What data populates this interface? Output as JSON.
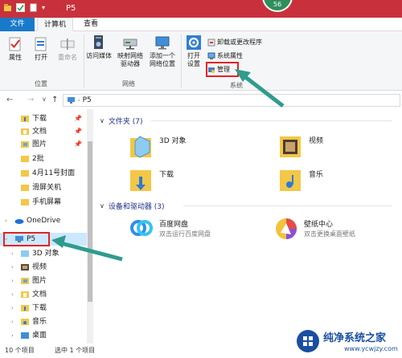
{
  "window": {
    "title": "P5",
    "badge": "56",
    "accent": "#c8313b"
  },
  "tabs": {
    "file": "文件",
    "computer": "计算机",
    "view": "查看"
  },
  "ribbon": {
    "properties": "属性",
    "open": "打开",
    "rename": "重命名",
    "location_group": "位置",
    "access_media": "访问媒体",
    "map_drive_l1": "映射网络",
    "map_drive_l2": "驱动器",
    "add_location_l1": "添加一个",
    "add_location_l2": "网络位置",
    "network_group": "网络",
    "open_settings_l1": "打开",
    "open_settings_l2": "设置",
    "uninstall": "卸载或更改程序",
    "system_props": "系统属性",
    "manage": "管理",
    "system_group": "系统"
  },
  "address": {
    "back": "←",
    "forward": "→",
    "dropdown": "∨",
    "up": "↑",
    "path": "P5"
  },
  "nav": {
    "items": [
      {
        "label": "下载",
        "pinned": true
      },
      {
        "label": "文档",
        "pinned": true
      },
      {
        "label": "图片",
        "pinned": true
      },
      {
        "label": "2批"
      },
      {
        "label": "4月11号封面"
      },
      {
        "label": "滑屏关机"
      },
      {
        "label": "手机屏幕"
      },
      {
        "label": "OneDrive"
      },
      {
        "label": "P5"
      },
      {
        "label": "3D 对象"
      },
      {
        "label": "视频"
      },
      {
        "label": "图片"
      },
      {
        "label": "文档"
      },
      {
        "label": "下载"
      },
      {
        "label": "音乐"
      },
      {
        "label": "桌面"
      }
    ]
  },
  "content": {
    "folders_header": "文件夹 (7)",
    "folders": [
      {
        "label": "3D 对象"
      },
      {
        "label": "视频"
      },
      {
        "label": "下载"
      },
      {
        "label": "音乐"
      }
    ],
    "devices_header": "设备和驱动器 (3)",
    "devices": [
      {
        "label": "百度网盘",
        "sub": "双击运行百度网盘"
      },
      {
        "label": "壁纸中心",
        "sub": "双击更换桌面壁纸"
      }
    ]
  },
  "status": {
    "items_count": "10 个项目",
    "selected": "选中 1 个项目"
  },
  "watermark": {
    "name": "纯净系统之家",
    "url": "www.ycwjzy.com"
  }
}
